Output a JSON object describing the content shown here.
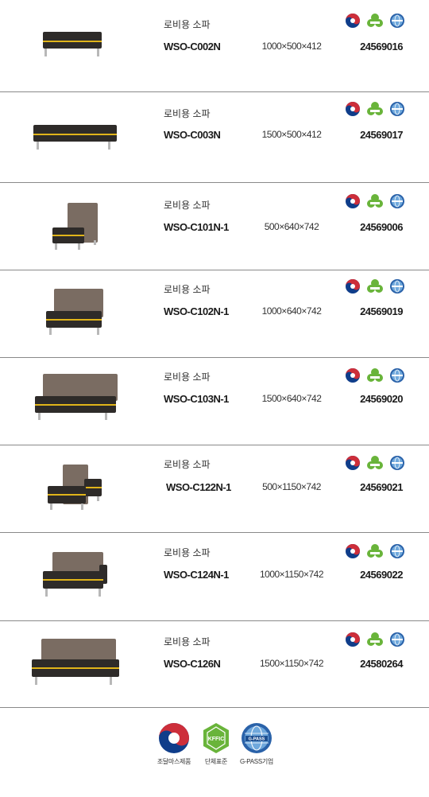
{
  "products": [
    {
      "category": "로비용 소파",
      "model": "WSO-C002N",
      "size": "1000×500×412",
      "code": "24569016"
    },
    {
      "category": "로비용 소파",
      "model": "WSO-C003N",
      "size": "1500×500×412",
      "code": "24569017"
    },
    {
      "category": "로비용 소파",
      "model": "WSO-C101N-1",
      "size": "500×640×742",
      "code": "24569006"
    },
    {
      "category": "로비용 소파",
      "model": "WSO-C102N-1",
      "size": "1000×640×742",
      "code": "24569019"
    },
    {
      "category": "로비용 소파",
      "model": "WSO-C103N-1",
      "size": "1500×640×742",
      "code": "24569020"
    },
    {
      "category": "로비용 소파",
      "model": "WSO-C122N-1",
      "size": "500×1150×742",
      "code": "24569021"
    },
    {
      "category": "로비용 소파",
      "model": "WSO-C124N-1",
      "size": "1000×1150×742",
      "code": "24569022"
    },
    {
      "category": "로비용 소파",
      "model": "WSO-C126N",
      "size": "1500×1150×742",
      "code": "24580264"
    }
  ],
  "footer": {
    "badges": [
      {
        "icon": "taegeuk-mark-icon",
        "caption": "조달마스제품"
      },
      {
        "icon": "kffic-standard-icon",
        "logo_text": "KFFIC",
        "caption": "단체표준"
      },
      {
        "icon": "gpass-globe-icon",
        "logo_text": "G-PASS",
        "caption": "G-PASS기업"
      }
    ]
  },
  "colors": {
    "seat": "#2e2b29",
    "back": "#7a6c62",
    "stripe": "#e0b41a",
    "legs": "#b8b8b8",
    "taegeuk_red": "#cd2e3a",
    "taegeuk_blue": "#0f3d8a",
    "kffic_green": "#69b43a",
    "gpass_blue": "#2a62a9",
    "divider": "#8a8a8a"
  }
}
